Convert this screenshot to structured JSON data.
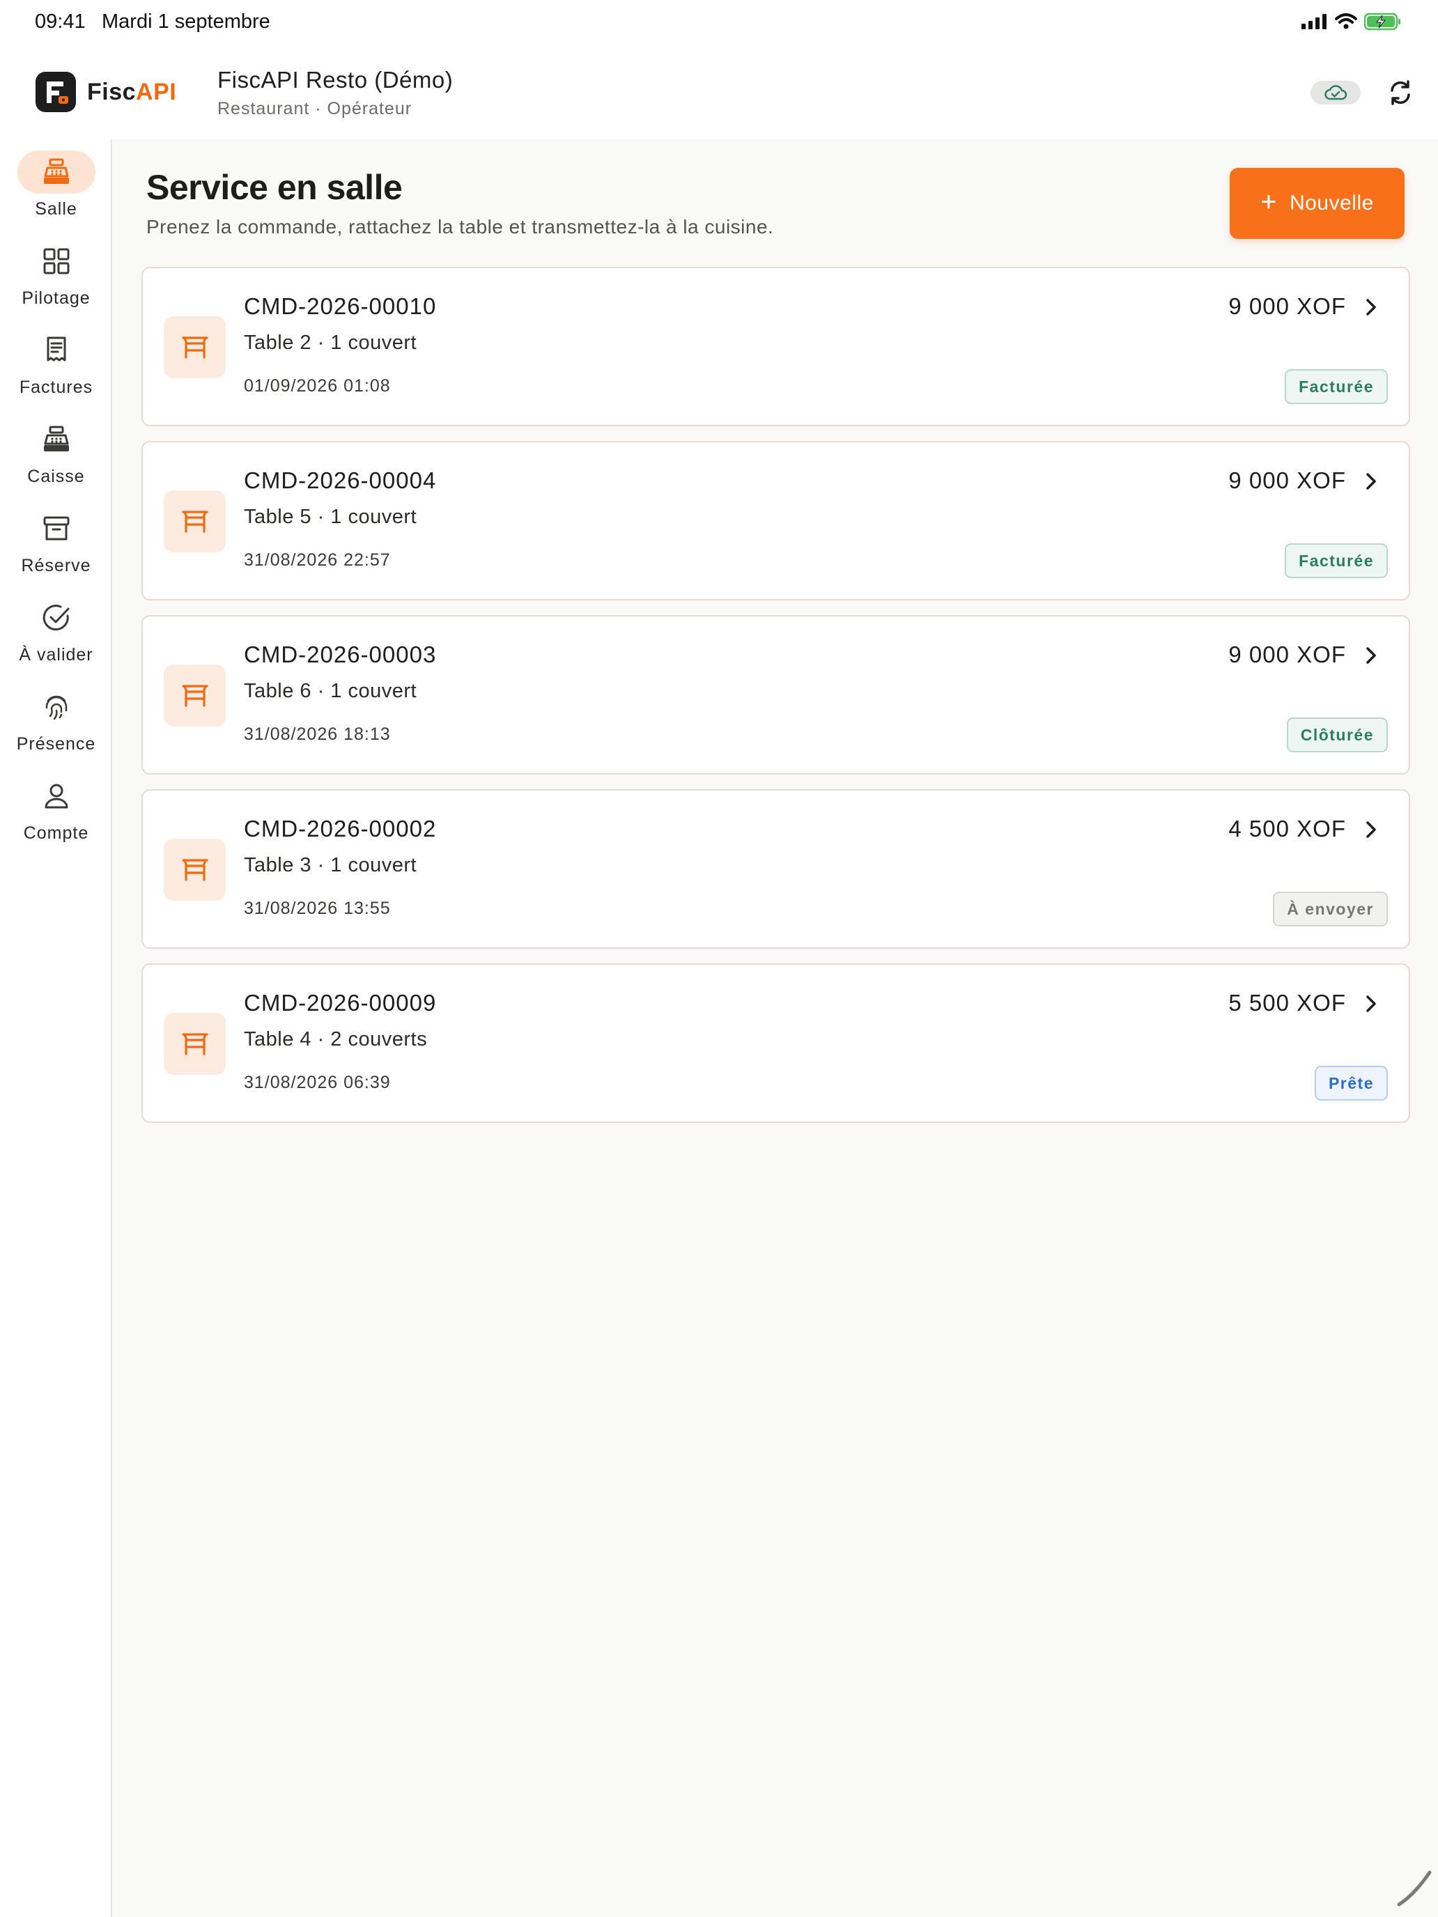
{
  "status_bar": {
    "time": "09:41",
    "date": "Mardi 1 septembre"
  },
  "header": {
    "logo_part1": "Fisc",
    "logo_part2": "API",
    "org_name": "FiscAPI Resto (Démo)",
    "org_sub": "Restaurant · Opérateur"
  },
  "sidebar": {
    "items": [
      {
        "label": "Salle",
        "icon": "cash-register-icon",
        "active": true
      },
      {
        "label": "Pilotage",
        "icon": "grid-icon",
        "active": false
      },
      {
        "label": "Factures",
        "icon": "receipt-icon",
        "active": false
      },
      {
        "label": "Caisse",
        "icon": "cash-register-icon",
        "active": false
      },
      {
        "label": "Réserve",
        "icon": "archive-box-icon",
        "active": false
      },
      {
        "label": "À valider",
        "icon": "check-circle-icon",
        "active": false
      },
      {
        "label": "Présence",
        "icon": "fingerprint-icon",
        "active": false
      },
      {
        "label": "Compte",
        "icon": "user-icon",
        "active": false
      }
    ]
  },
  "main": {
    "title": "Service en salle",
    "subtitle": "Prenez la commande, rattachez la table et transmettez-la à la cuisine.",
    "new_button": "Nouvelle",
    "orders": [
      {
        "id": "CMD-2026-00010",
        "table": "Table 2 · 1 couvert",
        "date": "01/09/2026 01:08",
        "amount": "9 000 XOF",
        "status": "Facturée",
        "status_color": "green"
      },
      {
        "id": "CMD-2026-00004",
        "table": "Table 5 · 1 couvert",
        "date": "31/08/2026 22:57",
        "amount": "9 000 XOF",
        "status": "Facturée",
        "status_color": "green"
      },
      {
        "id": "CMD-2026-00003",
        "table": "Table 6 · 1 couvert",
        "date": "31/08/2026 18:13",
        "amount": "9 000 XOF",
        "status": "Clôturée",
        "status_color": "green"
      },
      {
        "id": "CMD-2026-00002",
        "table": "Table 3 · 1 couvert",
        "date": "31/08/2026 13:55",
        "amount": "4 500 XOF",
        "status": "À envoyer",
        "status_color": "gray"
      },
      {
        "id": "CMD-2026-00009",
        "table": "Table 4 · 2 couverts",
        "date": "31/08/2026 06:39",
        "amount": "5 500 XOF",
        "status": "Prête",
        "status_color": "blue"
      }
    ]
  },
  "colors": {
    "accent": "#f8711a",
    "accent_soft": "#fde3d1",
    "green": "#2a7d62",
    "blue": "#2e6bd0"
  }
}
